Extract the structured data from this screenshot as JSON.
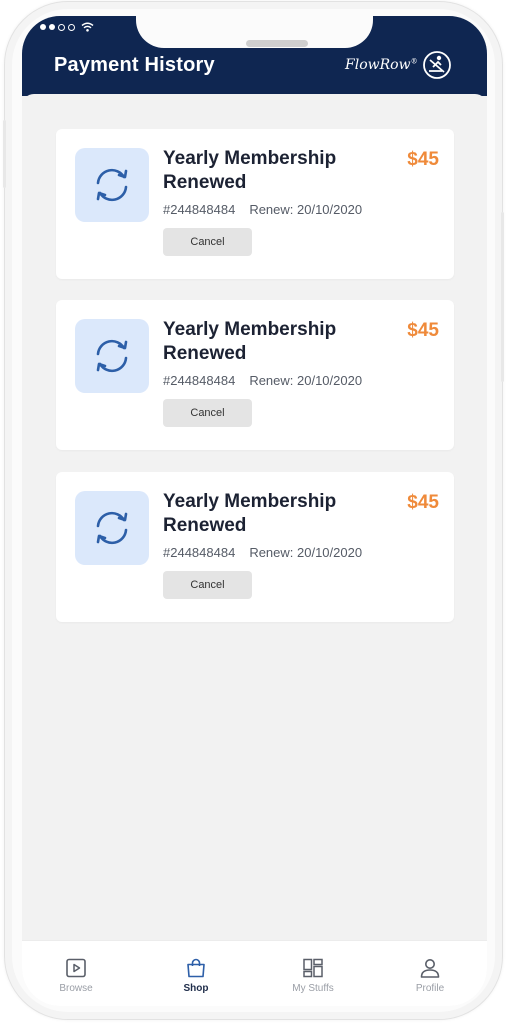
{
  "header": {
    "title": "Payment History",
    "logo_text": "FlowRow",
    "logo_mark": "®",
    "logo_icon": "rower-icon"
  },
  "payments": [
    {
      "title_line1": "Yearly Membership",
      "title_line2": "Renewed",
      "price": "$45",
      "id": "#244848484",
      "renew": "Renew: 20/10/2020",
      "cancel_label": "Cancel",
      "icon": "renew-cycle-icon"
    },
    {
      "title_line1": "Yearly Membership",
      "title_line2": "Renewed",
      "price": "$45",
      "id": "#244848484",
      "renew": "Renew: 20/10/2020",
      "cancel_label": "Cancel",
      "icon": "renew-cycle-icon"
    },
    {
      "title_line1": "Yearly Membership",
      "title_line2": "Renewed",
      "price": "$45",
      "id": "#244848484",
      "renew": "Renew: 20/10/2020",
      "cancel_label": "Cancel",
      "icon": "renew-cycle-icon"
    }
  ],
  "tabs": [
    {
      "label": "Browse",
      "icon": "play-square-icon",
      "active": false
    },
    {
      "label": "Shop",
      "icon": "shopping-bag-icon",
      "active": true
    },
    {
      "label": "My Stuffs",
      "icon": "dashboard-grid-icon",
      "active": false
    },
    {
      "label": "Profile",
      "icon": "user-icon",
      "active": false
    }
  ],
  "colors": {
    "header_bg": "#0f2651",
    "price": "#ef8a3a",
    "icon_bg": "#dbe8fb",
    "icon_stroke": "#2d5fa8",
    "active_tab": "#1f2d4a",
    "inactive_tab": "#9a9ea6"
  }
}
